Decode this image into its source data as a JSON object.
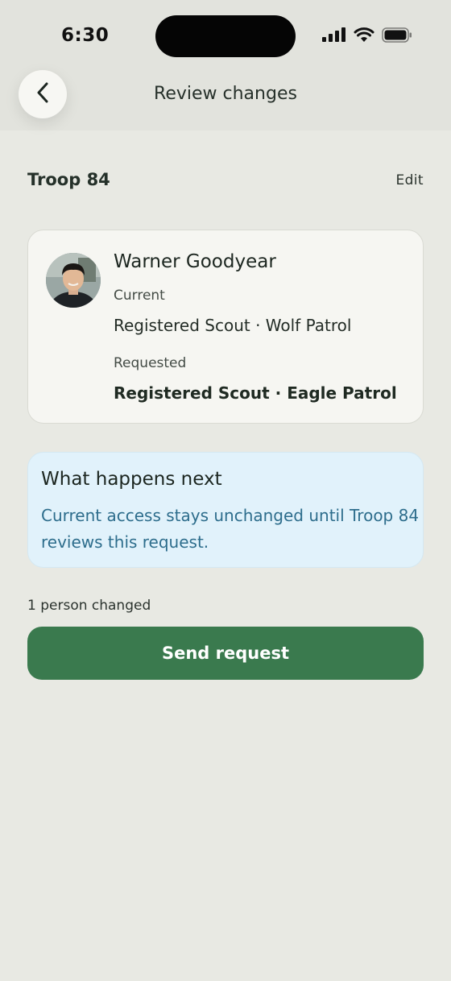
{
  "status_bar": {
    "time": "6:30",
    "icons": [
      "cellular-signal-icon",
      "wifi-icon",
      "battery-icon"
    ]
  },
  "nav": {
    "title": "Review changes",
    "back_icon": "chevron-left-icon"
  },
  "section": {
    "title": "Troop 84",
    "edit_label": "Edit"
  },
  "person": {
    "name": "Warner Goodyear",
    "current_label": "Current",
    "current_value": "Registered Scout · Wolf Patrol",
    "requested_label": "Requested",
    "requested_value": "Registered Scout · Eagle Patrol"
  },
  "info": {
    "title": "What happens next",
    "body": "Current access stays unchanged until Troop 84 reviews this request."
  },
  "summary": {
    "count_text": "1 person changed"
  },
  "actions": {
    "send_label": "Send request"
  },
  "colors": {
    "background": "#e8e9e3",
    "primary_button": "#3a7a4e",
    "info_background": "#e1f2fb",
    "info_text": "#2d6d8c"
  }
}
